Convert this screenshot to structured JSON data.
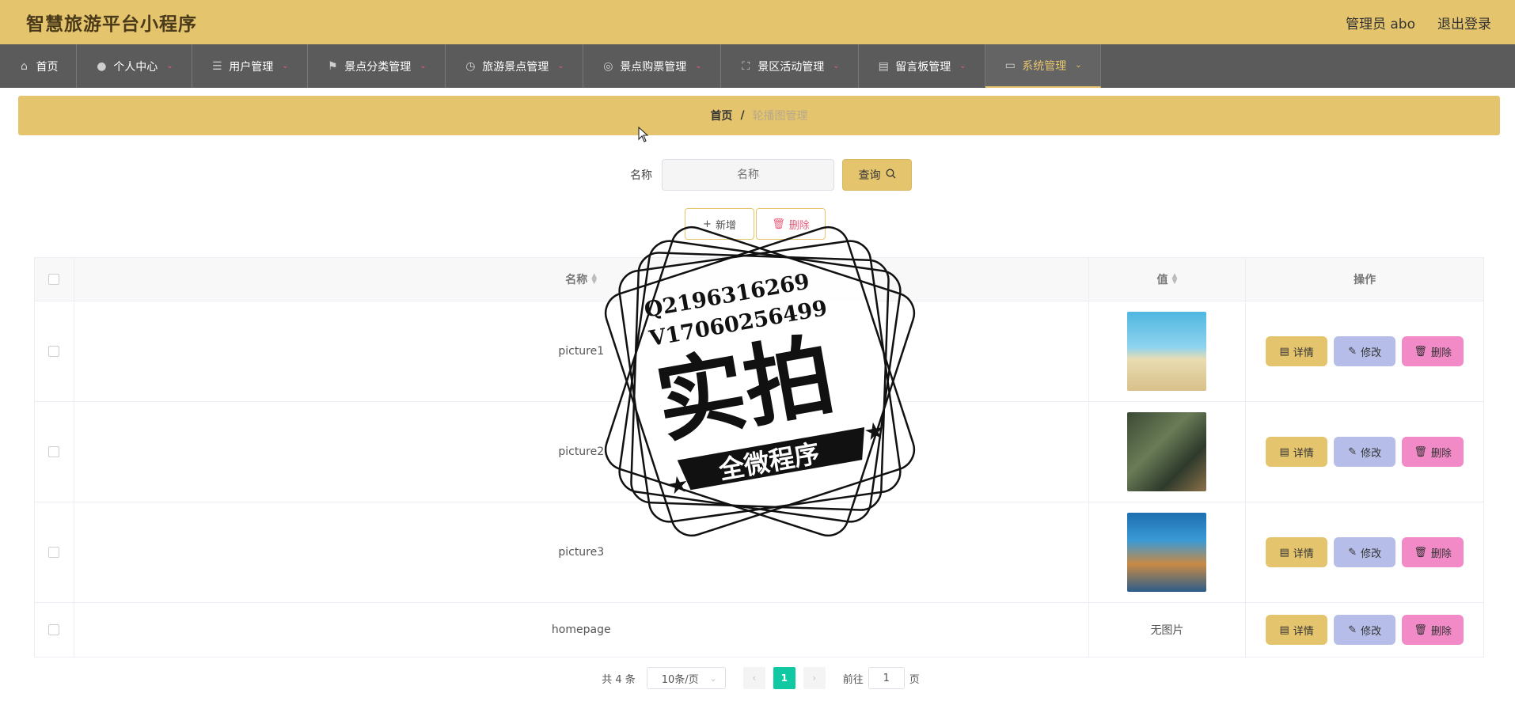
{
  "app": {
    "title": "智慧旅游平台小程序",
    "user": "管理员 abo",
    "logout": "退出登录"
  },
  "nav": {
    "items": [
      {
        "label": "首页",
        "icon": "home-icon",
        "has_caret": false
      },
      {
        "label": "个人中心",
        "icon": "user-icon",
        "has_caret": true
      },
      {
        "label": "用户管理",
        "icon": "list-icon",
        "has_caret": true
      },
      {
        "label": "景点分类管理",
        "icon": "flag-icon",
        "has_caret": true
      },
      {
        "label": "旅游景点管理",
        "icon": "clock-icon",
        "has_caret": true
      },
      {
        "label": "景点购票管理",
        "icon": "compass-icon",
        "has_caret": true
      },
      {
        "label": "景区活动管理",
        "icon": "fullscreen-icon",
        "has_caret": true
      },
      {
        "label": "留言板管理",
        "icon": "briefcase-icon",
        "has_caret": true
      },
      {
        "label": "系统管理",
        "icon": "monitor-icon",
        "has_caret": true,
        "active": true
      }
    ]
  },
  "breadcrumb": {
    "home": "首页",
    "separator": "/",
    "current": "轮播图管理"
  },
  "search": {
    "label": "名称",
    "placeholder": "名称",
    "query_button": "查询"
  },
  "actions": {
    "add": "新增",
    "delete": "删除"
  },
  "table": {
    "headers": {
      "name": "名称",
      "value": "值",
      "ops": "操作"
    },
    "rows": [
      {
        "name": "picture1",
        "value_type": "image"
      },
      {
        "name": "picture2",
        "value_type": "image"
      },
      {
        "name": "picture3",
        "value_type": "image"
      },
      {
        "name": "homepage",
        "value_type": "text",
        "value": "无图片"
      }
    ],
    "op_labels": {
      "detail": "详情",
      "edit": "修改",
      "delete": "删除"
    }
  },
  "pagination": {
    "total": "共 4 条",
    "page_size": "10条/页",
    "current_page": "1",
    "goto_prefix": "前往",
    "goto_value": "1",
    "goto_suffix": "页"
  },
  "watermark": {
    "line1": "Q2196316269",
    "line2": "V17060256499",
    "main": "实拍",
    "banner": "全微程序"
  },
  "colors": {
    "accent": "#e5c46e",
    "nav_bg": "#5b5b5b",
    "edit": "#b6bde8",
    "delete": "#f28ac8",
    "page_active": "#10c9a2"
  }
}
